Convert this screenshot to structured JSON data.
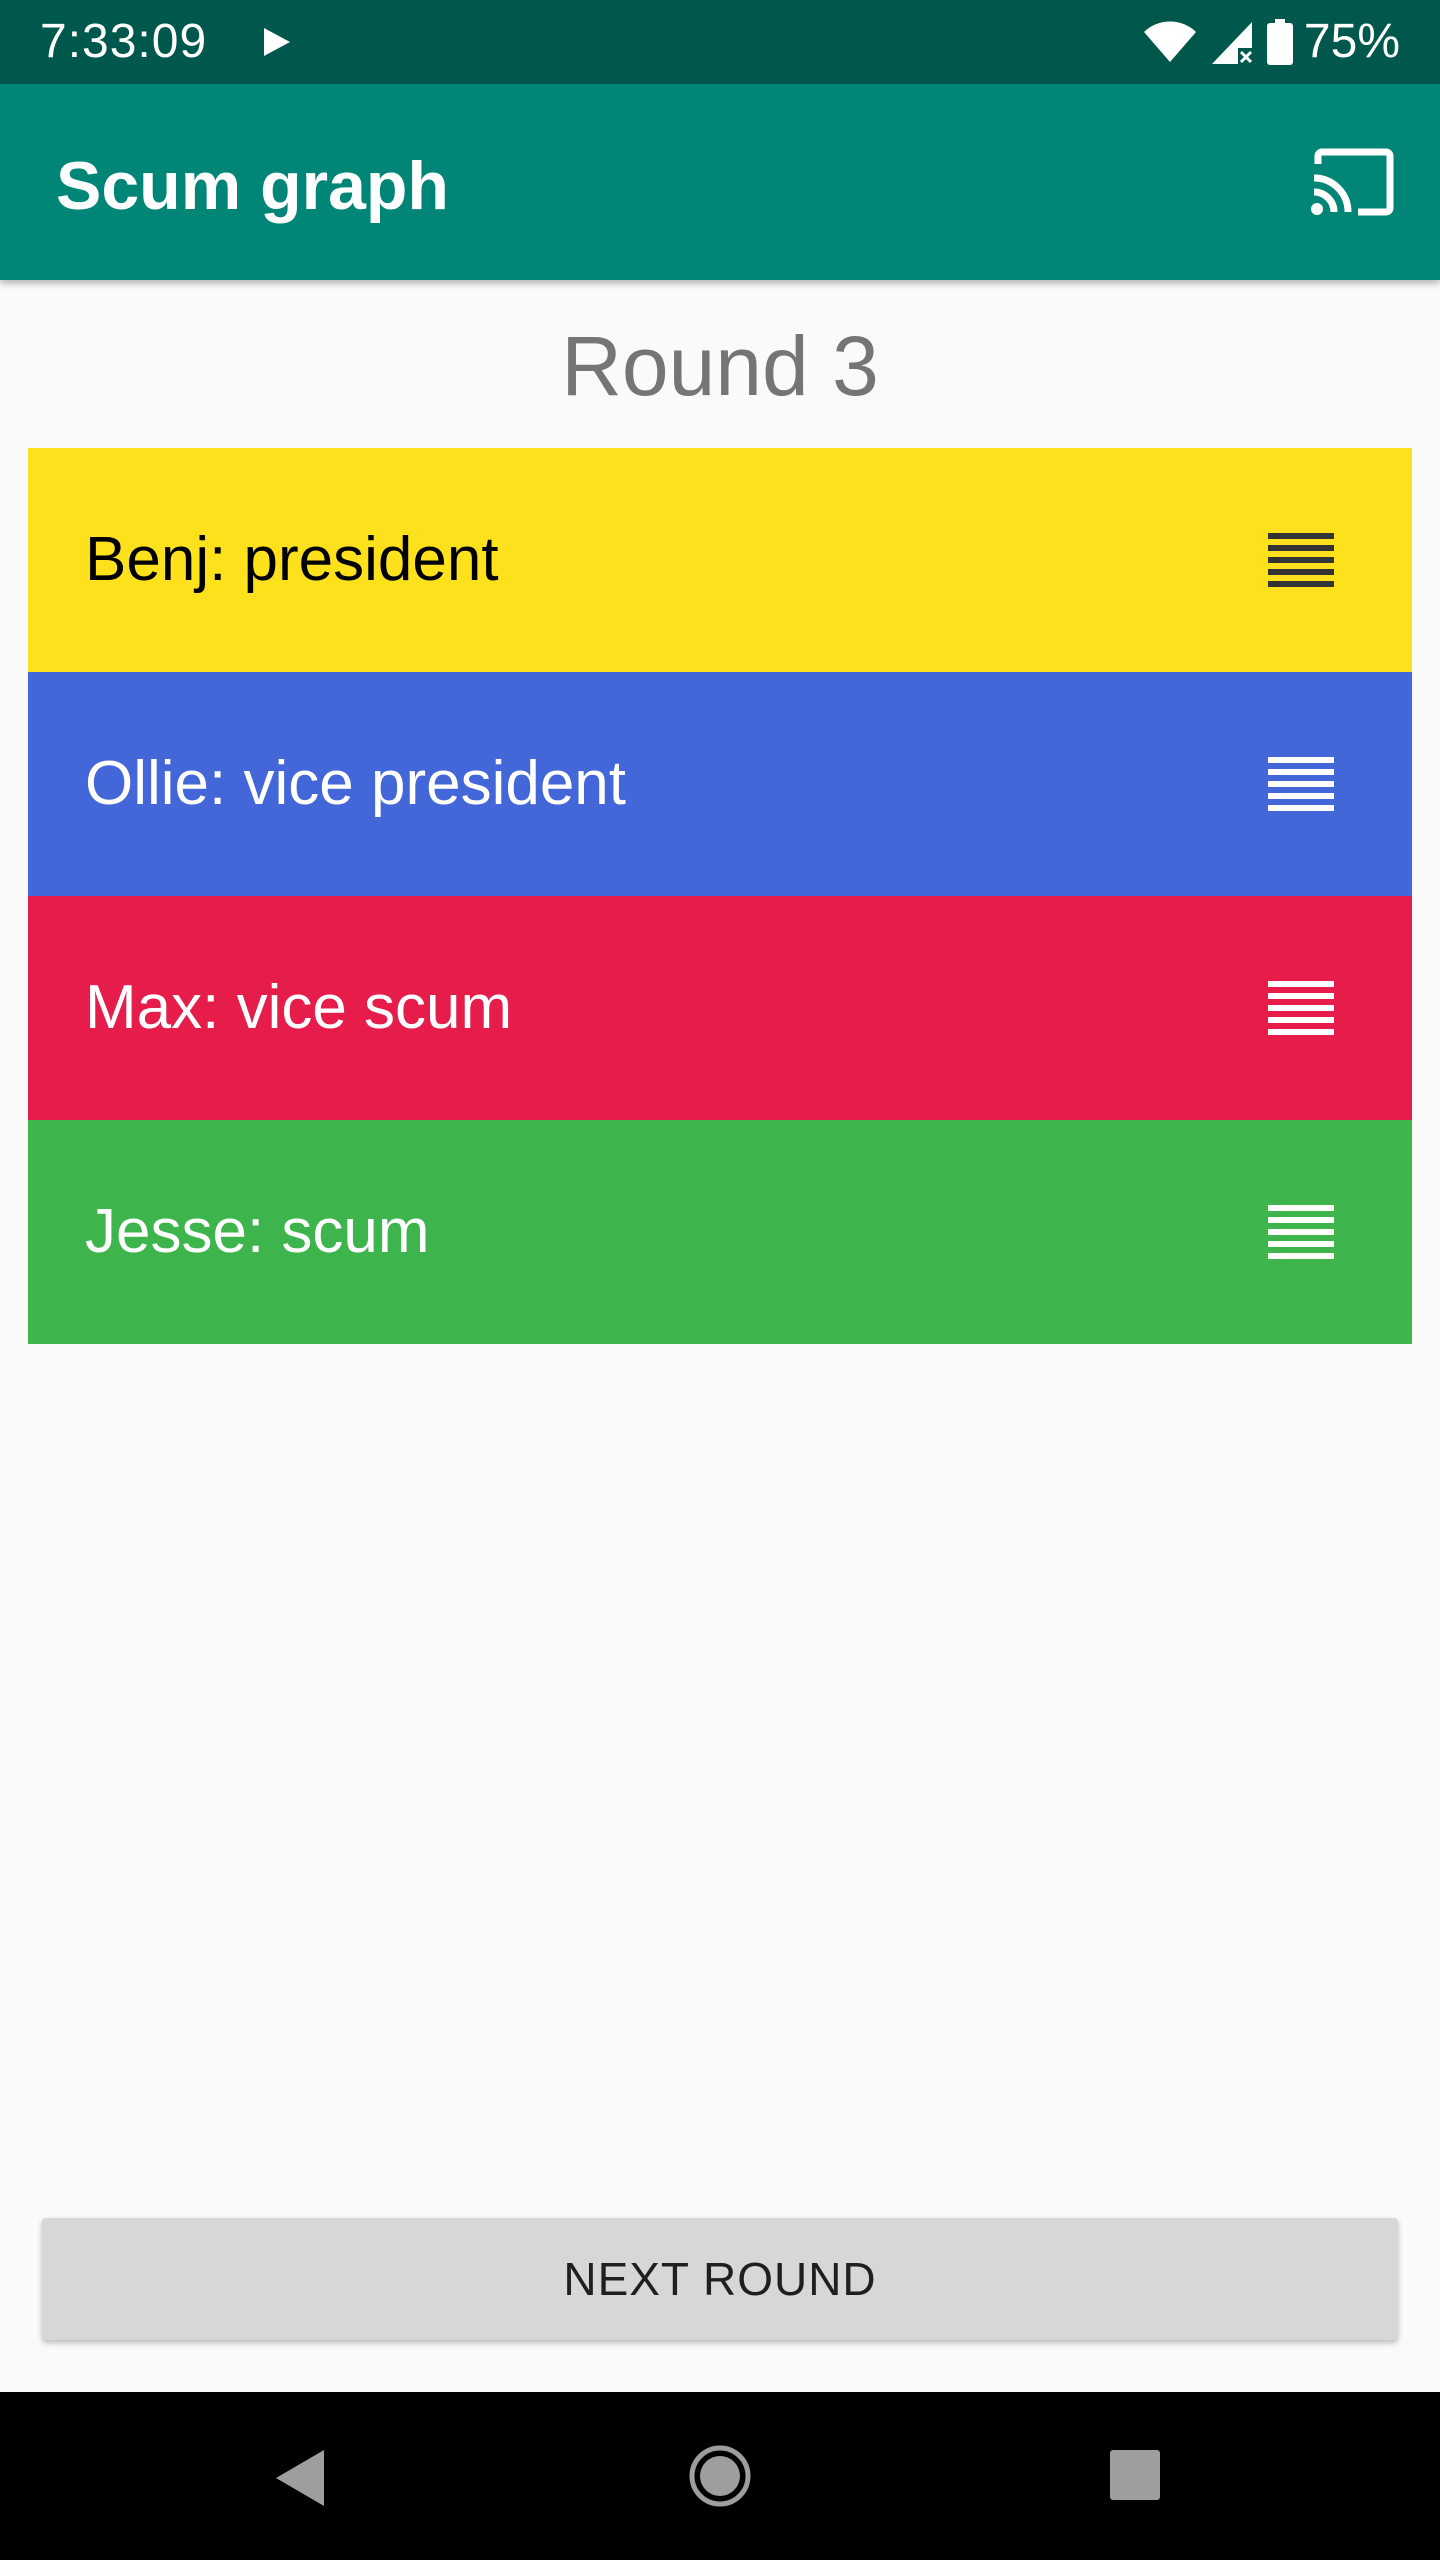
{
  "status_bar": {
    "time": "7:33:09",
    "battery": "75%",
    "icons": [
      "play-icon",
      "wifi-icon",
      "signal-icon",
      "battery-icon"
    ]
  },
  "app_bar": {
    "title": "Scum graph",
    "cast_icon": "cast-icon"
  },
  "round": {
    "title": "Round 3"
  },
  "ranks": [
    {
      "label": "Benj: president",
      "bg": "#fee11d",
      "text_color": "#000000",
      "handle_color": "#333333"
    },
    {
      "label": "Ollie: vice president",
      "bg": "#4366d8",
      "text_color": "#ffffff",
      "handle_color": "#ffffff"
    },
    {
      "label": "Max: vice scum",
      "bg": "#e61c4b",
      "text_color": "#ffffff",
      "handle_color": "#ffffff"
    },
    {
      "label": "Jesse: scum",
      "bg": "#3db44c",
      "text_color": "#ffffff",
      "handle_color": "#ffffff"
    }
  ],
  "next_button": {
    "label": "NEXT ROUND"
  },
  "colors": {
    "status_bar": "#00574b",
    "app_bar": "#008577",
    "background": "#fafafa",
    "button": "#d6d7d7"
  }
}
